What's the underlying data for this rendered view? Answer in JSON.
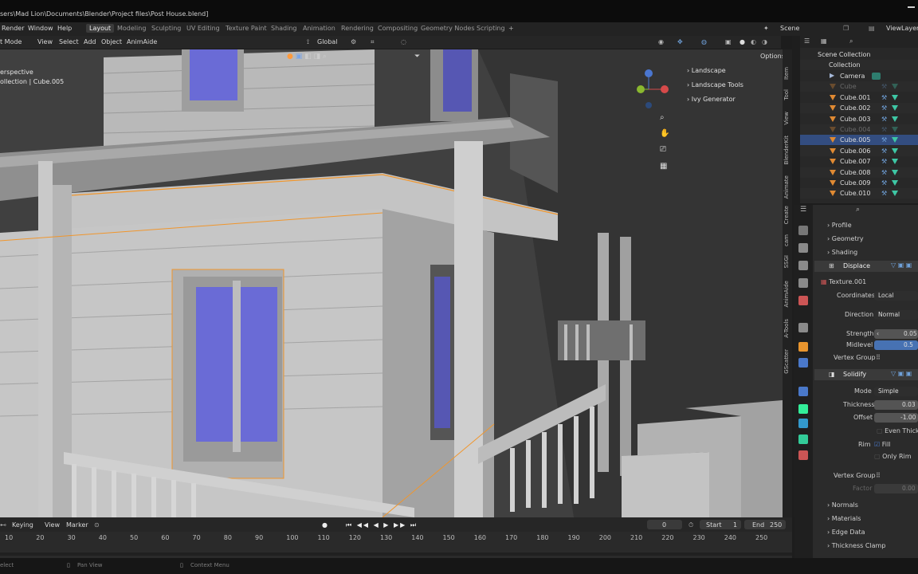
{
  "window": {
    "title": "sers\\Mad Lion\\Documents\\Blender\\Project files\\Post House.blend]"
  },
  "menu": {
    "items": [
      "Render",
      "Window",
      "Help"
    ],
    "workspaces": [
      "Layout",
      "Modeling",
      "Sculpting",
      "UV Editing",
      "Texture Paint",
      "Shading",
      "Animation",
      "Rendering",
      "Compositing",
      "Geometry Nodes",
      "Scripting"
    ],
    "add_tab": "+",
    "scene": "Scene",
    "view_layer": "ViewLayer"
  },
  "viewport_header": {
    "mode": "t Mode",
    "items": [
      "View",
      "Select",
      "Add",
      "Object",
      "AnimAide"
    ],
    "transform_orientation": "Global",
    "options": "Options"
  },
  "viewport": {
    "info_line1": "erspective",
    "info_line2": "ollection | Cube.005",
    "addon_panels": [
      "Landscape",
      "Landscape Tools",
      "Ivy Generator"
    ]
  },
  "npanel_tabs": [
    "Item",
    "Tool",
    "View",
    "BlenderKit",
    "Animate",
    "Create",
    "cam",
    "SSGI",
    "AnimAide",
    "A-Tools",
    "GScatter"
  ],
  "outliner": {
    "root": "Scene Collection",
    "collection": "Collection",
    "items": [
      {
        "name": "Camera",
        "state": "normal"
      },
      {
        "name": "Cube",
        "state": "dim"
      },
      {
        "name": "Cube.001",
        "state": "normal"
      },
      {
        "name": "Cube.002",
        "state": "normal"
      },
      {
        "name": "Cube.003",
        "state": "normal"
      },
      {
        "name": "Cube.004",
        "state": "dim"
      },
      {
        "name": "Cube.005",
        "state": "selected"
      },
      {
        "name": "Cube.006",
        "state": "normal"
      },
      {
        "name": "Cube.007",
        "state": "normal"
      },
      {
        "name": "Cube.008",
        "state": "normal"
      },
      {
        "name": "Cube.009",
        "state": "normal"
      },
      {
        "name": "Cube.010",
        "state": "normal"
      }
    ]
  },
  "properties": {
    "sections_top": [
      "Profile",
      "Geometry",
      "Shading"
    ],
    "displace": {
      "name": "Displace",
      "texture": "Texture.001",
      "coordinates_label": "Coordinates",
      "coordinates": "Local",
      "direction_label": "Direction",
      "direction": "Normal",
      "strength_label": "Strength",
      "strength": "0.05",
      "midlevel_label": "Midlevel",
      "midlevel": "0.5",
      "vertex_group_label": "Vertex Group"
    },
    "solidify": {
      "name": "Solidify",
      "mode_label": "Mode",
      "mode": "Simple",
      "thickness_label": "Thickness",
      "thickness": "0.03",
      "offset_label": "Offset",
      "offset": "-1.00",
      "even_thickness": "Even Thickne",
      "rim_label": "Rim",
      "fill": "Fill",
      "only_rim": "Only Rim",
      "vertex_group_label": "Vertex Group",
      "factor_label": "Factor",
      "factor": "0.00"
    },
    "sections_bottom": [
      "Normals",
      "Materials",
      "Edge Data",
      "Thickness Clamp"
    ]
  },
  "timeline": {
    "header": [
      "Keying",
      "View",
      "Marker"
    ],
    "current_frame": "0",
    "start_label": "Start",
    "start": "1",
    "end_label": "End",
    "end": "250",
    "ticks": [
      "10",
      "20",
      "30",
      "40",
      "50",
      "60",
      "70",
      "80",
      "90",
      "100",
      "110",
      "120",
      "130",
      "140",
      "150",
      "160",
      "170",
      "180",
      "190",
      "200",
      "210",
      "220",
      "230",
      "240",
      "250"
    ]
  },
  "statusbar": {
    "items": [
      "elect",
      "Pan View",
      "Context Menu"
    ]
  },
  "colors": {
    "accent_blue": "#4772b3",
    "selection_orange": "#f0962d",
    "window_glass": "#6a6bd6"
  }
}
